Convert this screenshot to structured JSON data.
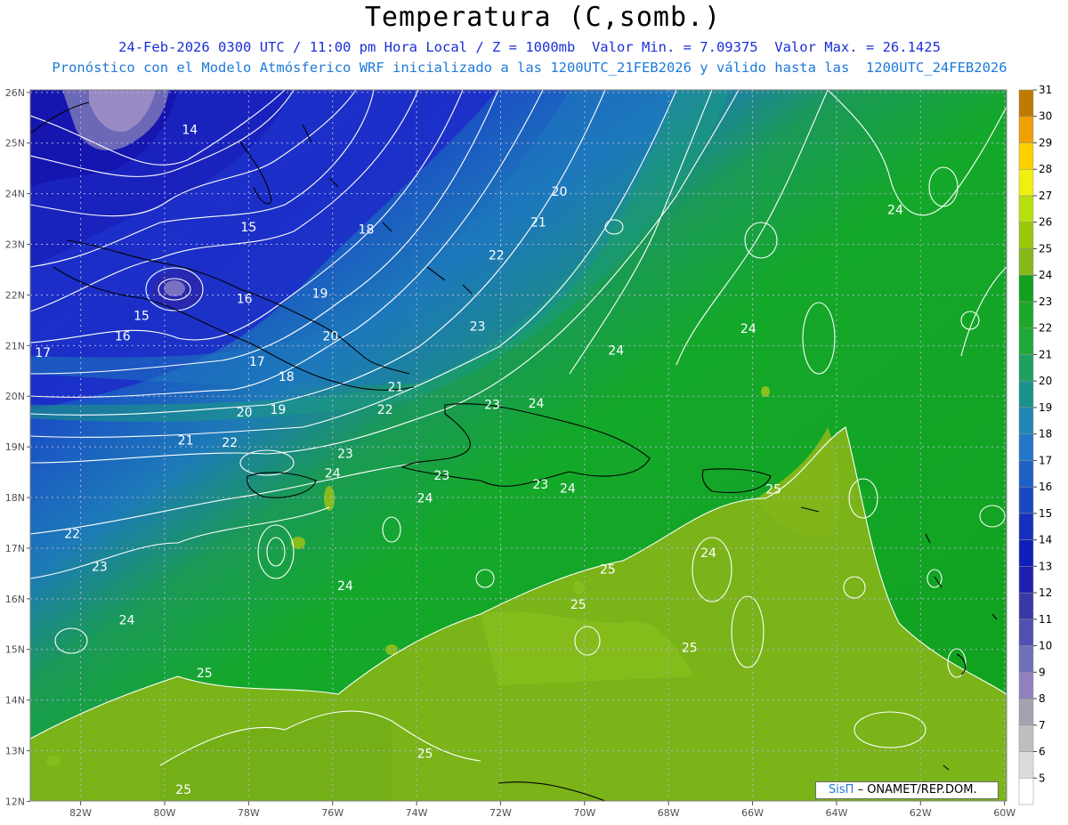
{
  "title": "Temperatura (C,somb.)",
  "subtitle_line1": "24-Feb-2026 0300 UTC / 11:00 pm Hora Local / Z = 1000mb  Valor Min. = 7.09375  Valor Max. = 26.1425",
  "subtitle_line2": "Pronóstico con el Modelo Atmósferico WRF inicializado a las 1200UTC_21FEB2026 y válido hasta las  1200UTC_24FEB2026",
  "credit": {
    "brand": "SisΠ",
    "text": "– ONAMET/REP.DOM."
  },
  "map": {
    "lat_labels": [
      "26N",
      "25N",
      "24N",
      "23N",
      "22N",
      "21N",
      "20N",
      "19N",
      "18N",
      "17N",
      "16N",
      "15N",
      "14N",
      "13N",
      "12N"
    ],
    "lon_labels": [
      "82W",
      "80W",
      "78W",
      "76W",
      "74W",
      "72W",
      "70W",
      "68W",
      "66W",
      "64W",
      "62W",
      "60W"
    ],
    "field_range": {
      "min": 7.09375,
      "max": 26.1425,
      "units": "C"
    },
    "contour_labels": [
      {
        "text": "14",
        "lon": -79.4,
        "lat": 25.18
      },
      {
        "text": "15",
        "lon": -78.0,
        "lat": 23.26
      },
      {
        "text": "18",
        "lon": -75.2,
        "lat": 23.21
      },
      {
        "text": "15",
        "lon": -80.55,
        "lat": 21.51
      },
      {
        "text": "16",
        "lon": -78.1,
        "lat": 21.84
      },
      {
        "text": "19",
        "lon": -76.3,
        "lat": 21.95
      },
      {
        "text": "20",
        "lon": -76.05,
        "lat": 21.1
      },
      {
        "text": "16",
        "lon": -81.0,
        "lat": 21.1
      },
      {
        "text": "17",
        "lon": -82.9,
        "lat": 20.78
      },
      {
        "text": "17",
        "lon": -77.8,
        "lat": 20.6
      },
      {
        "text": "18",
        "lon": -77.1,
        "lat": 20.3
      },
      {
        "text": "19",
        "lon": -77.3,
        "lat": 19.65
      },
      {
        "text": "20",
        "lon": -78.1,
        "lat": 19.6
      },
      {
        "text": "21",
        "lon": -74.5,
        "lat": 20.1
      },
      {
        "text": "22",
        "lon": -74.75,
        "lat": 19.65
      },
      {
        "text": "21",
        "lon": -79.5,
        "lat": 19.05
      },
      {
        "text": "22",
        "lon": -78.45,
        "lat": 19.0
      },
      {
        "text": "23",
        "lon": -75.7,
        "lat": 18.78
      },
      {
        "text": "24",
        "lon": -76.0,
        "lat": 18.4
      },
      {
        "text": "23",
        "lon": -73.4,
        "lat": 18.35
      },
      {
        "text": "24",
        "lon": -73.8,
        "lat": 17.9
      },
      {
        "text": "23",
        "lon": -72.2,
        "lat": 19.75
      },
      {
        "text": "24",
        "lon": -71.15,
        "lat": 19.78
      },
      {
        "text": "23",
        "lon": -71.05,
        "lat": 18.18
      },
      {
        "text": "24",
        "lon": -70.4,
        "lat": 18.1
      },
      {
        "text": "20",
        "lon": -70.6,
        "lat": 23.96
      },
      {
        "text": "21",
        "lon": -71.1,
        "lat": 23.35
      },
      {
        "text": "22",
        "lon": -72.1,
        "lat": 22.7
      },
      {
        "text": "23",
        "lon": -72.55,
        "lat": 21.3
      },
      {
        "text": "24",
        "lon": -69.25,
        "lat": 20.82
      },
      {
        "text": "24",
        "lon": -66.1,
        "lat": 21.25
      },
      {
        "text": "24",
        "lon": -62.6,
        "lat": 23.6
      },
      {
        "text": "25",
        "lon": -65.5,
        "lat": 18.08
      },
      {
        "text": "24",
        "lon": -67.05,
        "lat": 16.82
      },
      {
        "text": "25",
        "lon": -69.45,
        "lat": 16.5
      },
      {
        "text": "25",
        "lon": -70.15,
        "lat": 15.8
      },
      {
        "text": "25",
        "lon": -67.5,
        "lat": 14.95
      },
      {
        "text": "22",
        "lon": -82.2,
        "lat": 17.2
      },
      {
        "text": "23",
        "lon": -81.55,
        "lat": 16.55
      },
      {
        "text": "24",
        "lon": -75.7,
        "lat": 16.17
      },
      {
        "text": "24",
        "lon": -80.9,
        "lat": 15.5
      },
      {
        "text": "25",
        "lon": -79.05,
        "lat": 14.45
      },
      {
        "text": "25",
        "lon": -73.8,
        "lat": 12.86
      },
      {
        "text": "25",
        "lon": -79.55,
        "lat": 12.15
      }
    ]
  },
  "colorbar": {
    "labels": [
      "5",
      "6",
      "7",
      "8",
      "9",
      "10",
      "11",
      "12",
      "13",
      "14",
      "15",
      "16",
      "17",
      "18",
      "19",
      "20",
      "21",
      "22",
      "23",
      "24",
      "25",
      "26",
      "27",
      "28",
      "29",
      "30",
      "31"
    ],
    "colors": [
      "#ffffff",
      "#dcdcdc",
      "#bebebe",
      "#a3a3b0",
      "#9080c0",
      "#7070b8",
      "#5050b0",
      "#3838a8",
      "#1f1fb0",
      "#0e1eb8",
      "#1530bc",
      "#1848c0",
      "#1e60c4",
      "#2277c8",
      "#1f87b6",
      "#1b928c",
      "#1ea060",
      "#20a838",
      "#1ea82a",
      "#12a01e",
      "#86b81a",
      "#9ac80a",
      "#b8e010",
      "#f0f010",
      "#ffd000",
      "#f0a000",
      "#c07a00"
    ]
  }
}
